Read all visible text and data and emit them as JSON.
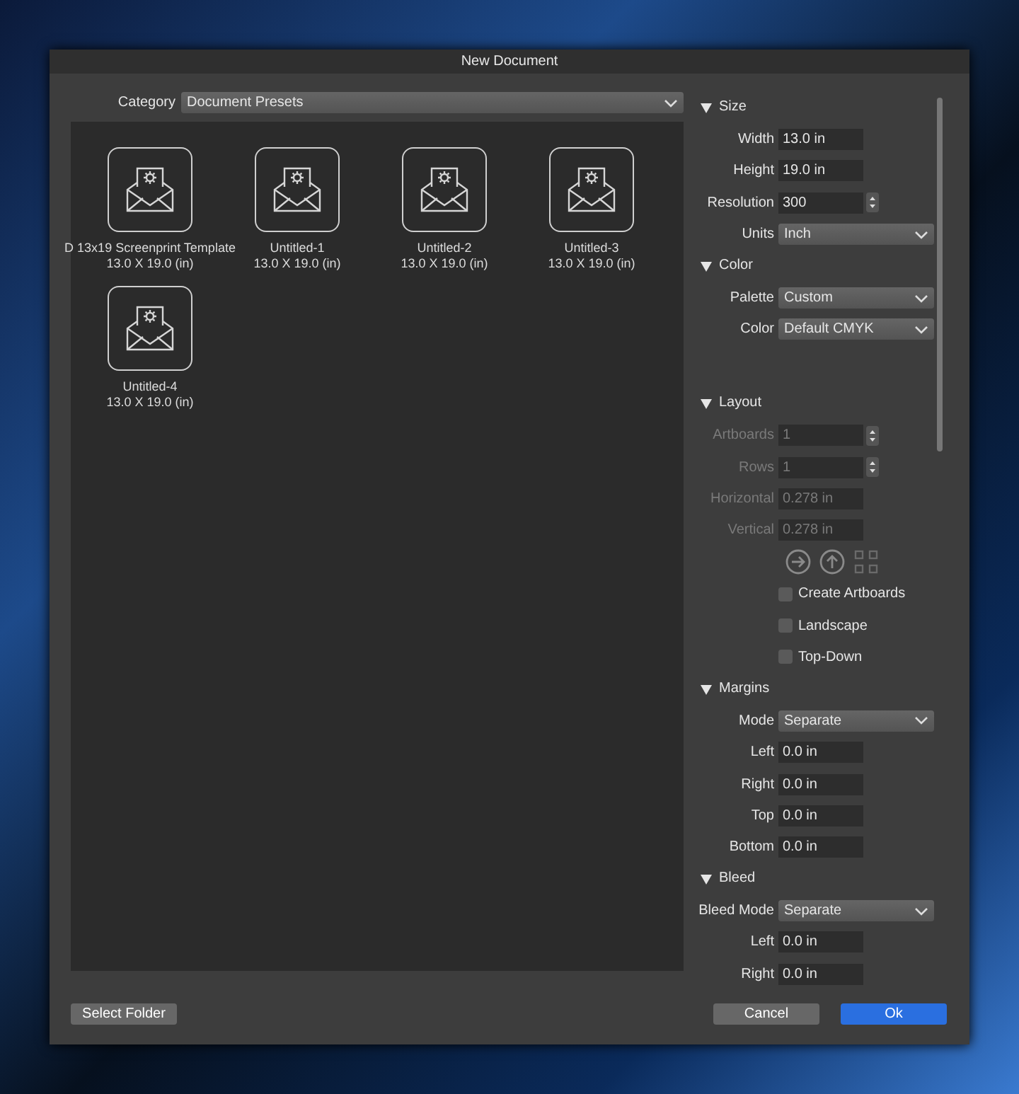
{
  "window": {
    "title": "New Document"
  },
  "category": {
    "label": "Category",
    "value": "Document Presets"
  },
  "presets": [
    {
      "name": "D 13x19 Screenprint Template",
      "size": "13.0 X 19.0 (in)"
    },
    {
      "name": "Untitled-1",
      "size": "13.0 X 19.0 (in)"
    },
    {
      "name": "Untitled-2",
      "size": "13.0 X 19.0 (in)"
    },
    {
      "name": "Untitled-3",
      "size": "13.0 X 19.0 (in)"
    },
    {
      "name": "Untitled-4",
      "size": "13.0 X 19.0 (in)"
    }
  ],
  "sections": [
    {
      "title": "Size",
      "expanded": true,
      "rows": [
        {
          "kind": "field",
          "label": "Width",
          "value": "13.0 in",
          "disabled": false
        },
        {
          "kind": "field",
          "label": "Height",
          "value": "19.0 in",
          "disabled": false
        },
        {
          "kind": "stepper",
          "label": "Resolution",
          "value": "300",
          "disabled": false
        },
        {
          "kind": "select",
          "label": "Units",
          "value": "Inch",
          "disabled": false
        }
      ]
    },
    {
      "title": "Color",
      "expanded": true,
      "rows": [
        {
          "kind": "select",
          "label": "Palette",
          "value": "Custom",
          "disabled": false
        },
        {
          "kind": "select",
          "label": "Color",
          "value": "Default CMYK",
          "disabled": false
        },
        {
          "kind": "spacer"
        }
      ]
    },
    {
      "title": "Layout",
      "expanded": true,
      "rows": [
        {
          "kind": "stepper",
          "label": "Artboards",
          "value": "1",
          "disabled": true
        },
        {
          "kind": "stepper",
          "label": "Rows",
          "value": "1",
          "disabled": true
        },
        {
          "kind": "field",
          "label": "Horizontal",
          "value": "0.278 in",
          "disabled": true
        },
        {
          "kind": "field",
          "label": "Vertical",
          "value": "0.278 in",
          "disabled": true
        },
        {
          "kind": "icons"
        },
        {
          "kind": "checkbox",
          "label": "Create Artboards",
          "checked": false
        },
        {
          "kind": "checkbox",
          "label": "Landscape",
          "checked": false
        },
        {
          "kind": "checkbox",
          "label": "Top-Down",
          "checked": false
        }
      ]
    },
    {
      "title": "Margins",
      "expanded": true,
      "rows": [
        {
          "kind": "select",
          "label": "Mode",
          "value": "Separate",
          "disabled": false
        },
        {
          "kind": "field",
          "label": "Left",
          "value": "0.0 in",
          "disabled": false
        },
        {
          "kind": "field",
          "label": "Right",
          "value": "0.0 in",
          "disabled": false
        },
        {
          "kind": "field",
          "label": "Top",
          "value": "0.0 in",
          "disabled": false
        },
        {
          "kind": "field",
          "label": "Bottom",
          "value": "0.0 in",
          "disabled": false
        }
      ]
    },
    {
      "title": "Bleed",
      "expanded": true,
      "rows": [
        {
          "kind": "select",
          "label": "Bleed Mode",
          "value": "Separate",
          "disabled": false
        },
        {
          "kind": "field",
          "label": "Left",
          "value": "0.0 in",
          "disabled": false
        },
        {
          "kind": "field",
          "label": "Right",
          "value": "0.0 in",
          "disabled": false
        }
      ]
    }
  ],
  "buttons": [
    {
      "label": "Select Folder",
      "kind": "secondary"
    },
    {
      "label": "Cancel",
      "kind": "secondary"
    },
    {
      "label": "Ok",
      "kind": "primary"
    }
  ]
}
